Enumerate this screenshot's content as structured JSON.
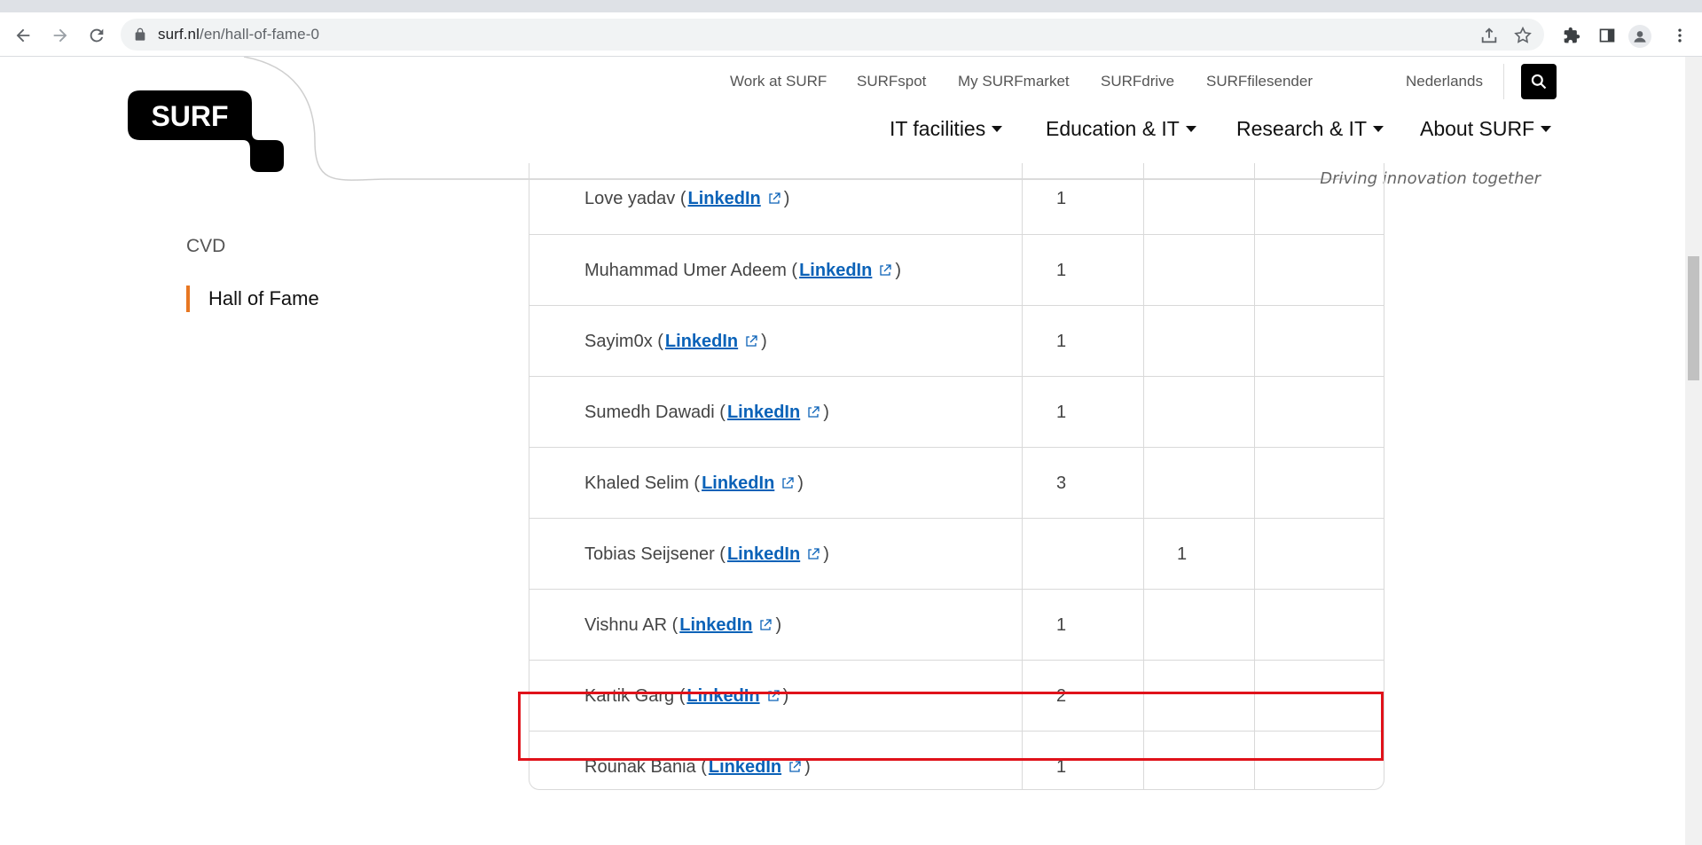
{
  "browser": {
    "url_domain": "surf.nl",
    "url_path": "/en/hall-of-fame-0"
  },
  "header": {
    "logo_text": "SURF",
    "top_links": [
      "Work at SURF",
      "SURFspot",
      "My SURFmarket",
      "SURFdrive",
      "SURFfilesender"
    ],
    "language": "Nederlands",
    "main_nav": [
      "IT facilities",
      "Education & IT",
      "Research & IT",
      "About SURF"
    ],
    "tagline": "Driving innovation together"
  },
  "sidebar": {
    "items": [
      {
        "label": "CVD",
        "active": false
      },
      {
        "label": "Hall of Fame",
        "active": true
      }
    ]
  },
  "table": {
    "link_label": "LinkedIn",
    "rows": [
      {
        "name": "Love yadav",
        "col1": "1",
        "col2": "",
        "col3": ""
      },
      {
        "name": "Muhammad Umer Adeem",
        "col1": "1",
        "col2": "",
        "col3": ""
      },
      {
        "name": "Sayim0x",
        "col1": "1",
        "col2": "",
        "col3": ""
      },
      {
        "name": "Sumedh Dawadi",
        "col1": "1",
        "col2": "",
        "col3": ""
      },
      {
        "name": "Khaled Selim",
        "col1": "3",
        "col2": "",
        "col3": ""
      },
      {
        "name": "Tobias Seijsener",
        "col1": "",
        "col2": "1",
        "col3": ""
      },
      {
        "name": "Vishnu AR",
        "col1": "1",
        "col2": "",
        "col3": ""
      },
      {
        "name": "Kartik Garg",
        "col1": "2",
        "col2": "",
        "col3": "",
        "highlighted": true
      },
      {
        "name": "Rounak Bania",
        "col1": "1",
        "col2": "",
        "col3": ""
      }
    ]
  },
  "colors": {
    "accent": "#e87722",
    "link": "#0a62b8",
    "highlight": "#e0121a"
  }
}
